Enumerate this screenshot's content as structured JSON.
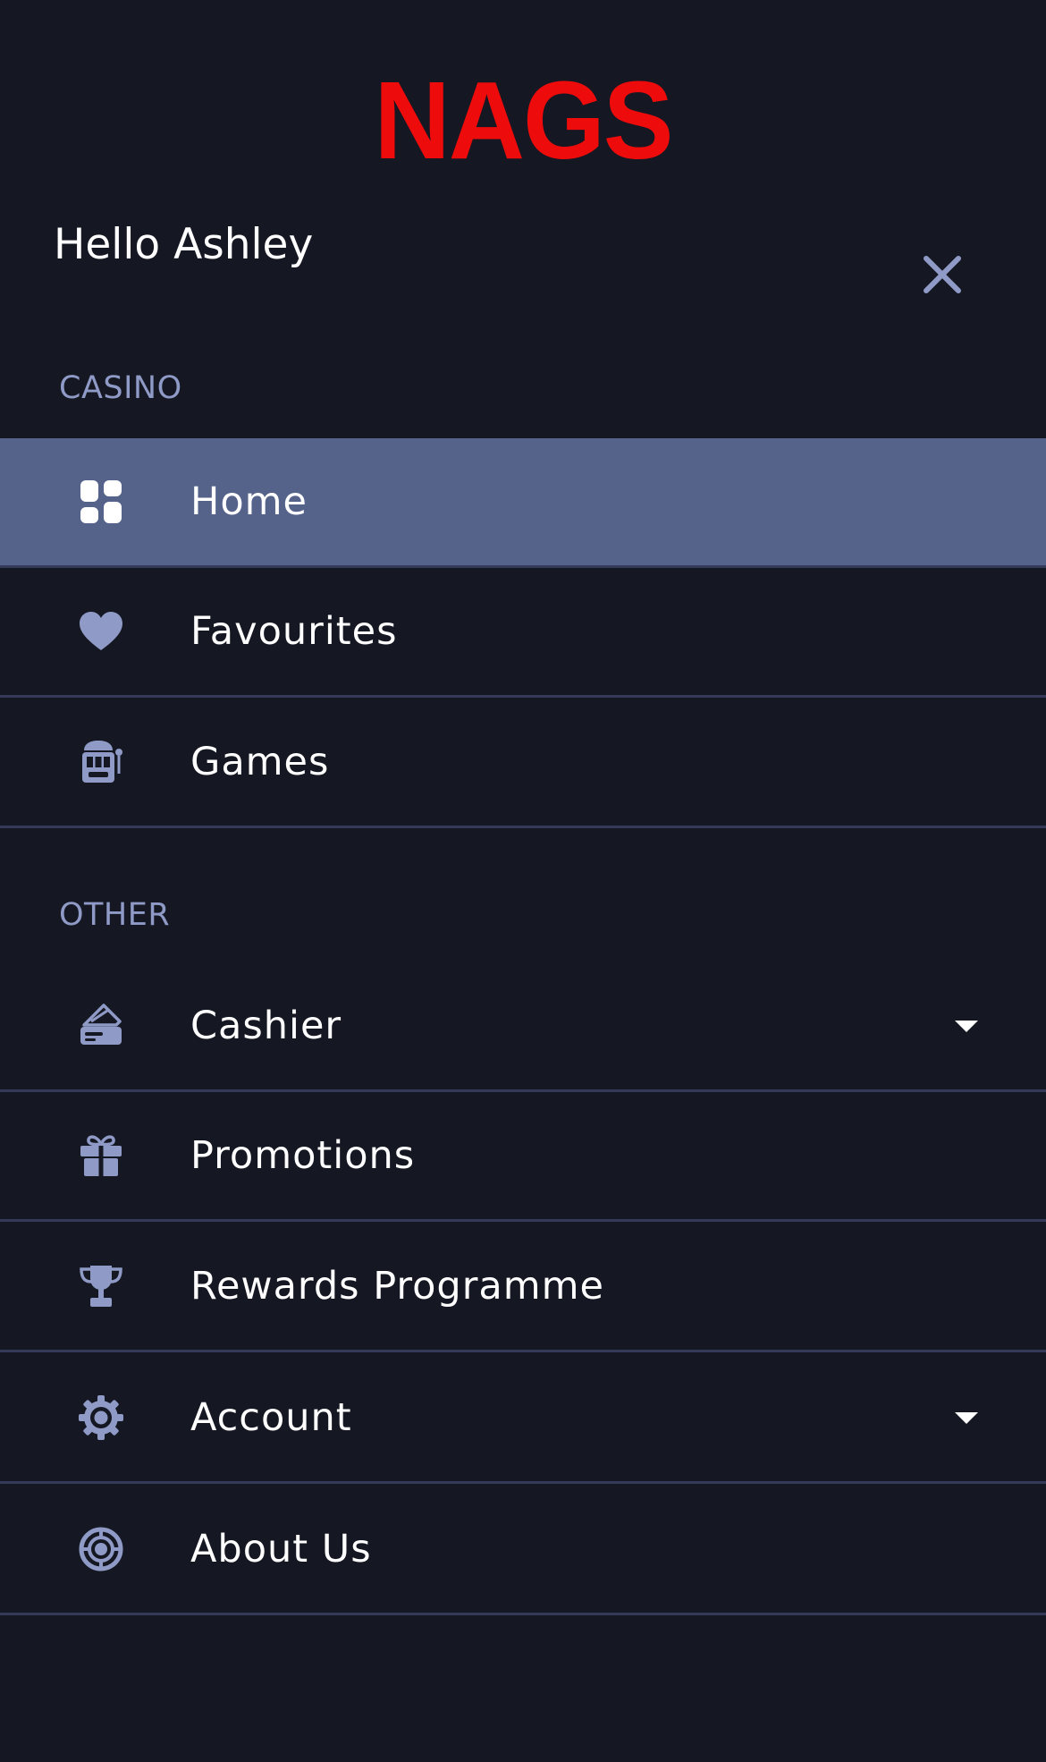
{
  "brand": {
    "logo_text": "NAGS",
    "logo_color": "#ee0b0b"
  },
  "greeting": "Hello Ashley",
  "close_icon": "close-icon",
  "colors": {
    "background": "#151722",
    "active_item": "#55628a",
    "section_label": "#8f9bc6",
    "icon": "#8f9bc6",
    "divider": "#343a57",
    "text": "#ffffff"
  },
  "sections": {
    "casino": {
      "title": "CASINO",
      "items": [
        {
          "label": "Home",
          "icon": "dashboard-icon",
          "active": true
        },
        {
          "label": "Favourites",
          "icon": "heart-icon"
        },
        {
          "label": "Games",
          "icon": "slot-machine-icon"
        }
      ]
    },
    "other": {
      "title": "OTHER",
      "items": [
        {
          "label": "Cashier",
          "icon": "wallet-card-icon",
          "has_dropdown": true
        },
        {
          "label": "Promotions",
          "icon": "gift-icon"
        },
        {
          "label": "Rewards Programme",
          "icon": "trophy-icon"
        },
        {
          "label": "Account",
          "icon": "gear-icon",
          "has_dropdown": true
        },
        {
          "label": "About Us",
          "icon": "poker-chip-icon"
        }
      ]
    }
  }
}
